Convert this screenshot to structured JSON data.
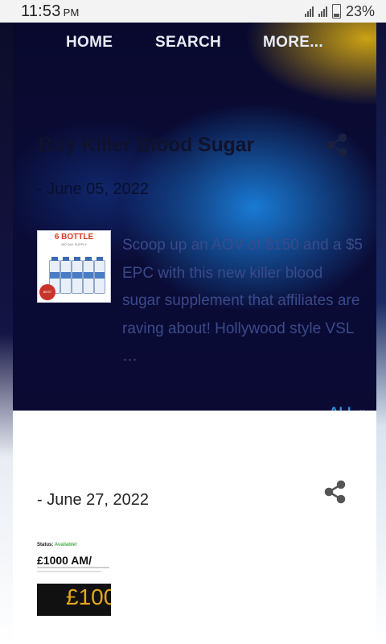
{
  "status_bar": {
    "time": "11:53",
    "ampm": "PM",
    "battery": "23%"
  },
  "nav": {
    "items": [
      "HOME",
      "SEARCH",
      "MORE..."
    ]
  },
  "posts": [
    {
      "title": "Buy Killer Blood Sugar",
      "date": "- June 05, 2022",
      "thumbnail": {
        "headline": "6 BOTTLE",
        "subline": "180 DAY SUPPLY",
        "badge": "BEST VALUE"
      },
      "excerpt": "Scoop up an AOV of $150 and a $5 EPC with this new killer blood sugar supplement that affiliates are raving about! Hollywood style VSL …",
      "readmore": "ALL »"
    },
    {
      "date": "- June 27, 2022",
      "thumbnail": {
        "status": "Status:",
        "status_value": "Available!",
        "headline": "£1000 AM/",
        "price": "£100"
      }
    }
  ],
  "colors": {
    "accent": "#2f8fe0",
    "hero_dark": "#0a0a33",
    "gold": "#d6aa12"
  }
}
